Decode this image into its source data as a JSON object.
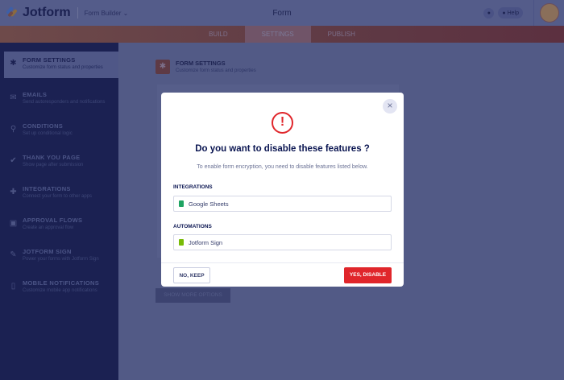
{
  "header": {
    "logo": "Jotform",
    "product": "Form Builder",
    "title": "Form",
    "help": "Help"
  },
  "tabs": [
    {
      "label": "BUILD"
    },
    {
      "label": "SETTINGS"
    },
    {
      "label": "PUBLISH"
    }
  ],
  "sidebar": {
    "items": [
      {
        "title": "FORM SETTINGS",
        "subtitle": "Customize form status and properties",
        "icon": "gear-icon"
      },
      {
        "title": "EMAILS",
        "subtitle": "Send autoresponders and notifications",
        "icon": "envelope-icon"
      },
      {
        "title": "CONDITIONS",
        "subtitle": "Set up conditional logic",
        "icon": "flow-icon"
      },
      {
        "title": "THANK YOU PAGE",
        "subtitle": "Show page after submission",
        "icon": "check-circle-icon"
      },
      {
        "title": "INTEGRATIONS",
        "subtitle": "Connect your form to other apps",
        "icon": "puzzle-icon"
      },
      {
        "title": "APPROVAL FLOWS",
        "subtitle": "Create an approval flow",
        "icon": "approval-icon"
      },
      {
        "title": "JOTFORM SIGN",
        "subtitle": "Power your forms with Jotform Sign",
        "icon": "pen-icon"
      },
      {
        "title": "MOBILE NOTIFICATIONS",
        "subtitle": "Customize mobile app notifications",
        "icon": "mobile-icon"
      }
    ]
  },
  "main": {
    "title": "FORM SETTINGS",
    "subtitle": "Customize form status and properties",
    "show_more": "SHOW MORE OPTIONS"
  },
  "modal": {
    "title": "Do you want to disable these features ?",
    "subtitle": "To enable form encryption, you need to disable features listed below.",
    "sections": [
      {
        "label": "INTEGRATIONS",
        "item": "Google Sheets",
        "color": "#1fa463"
      },
      {
        "label": "AUTOMATIONS",
        "item": "Jotform Sign",
        "color": "#78bb07"
      }
    ],
    "cancel": "NO, KEEP",
    "confirm": "YES, DISABLE"
  }
}
